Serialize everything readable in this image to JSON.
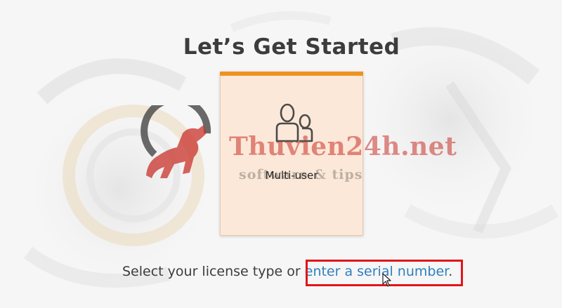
{
  "page": {
    "title": "Let’s Get Started"
  },
  "license_tiles": [
    {
      "label": "Multi-user",
      "icon": "multi-user-icon"
    }
  ],
  "prompt": {
    "text_before": "Select your license type or ",
    "link_text": "enter a serial number",
    "text_after": "."
  },
  "watermark": {
    "main": "Thuvien24h.net",
    "sub": "software & tips"
  },
  "colors": {
    "accent_orange": "#ee9322",
    "link_blue": "#2f7fbf",
    "highlight_red": "#e1151a"
  }
}
